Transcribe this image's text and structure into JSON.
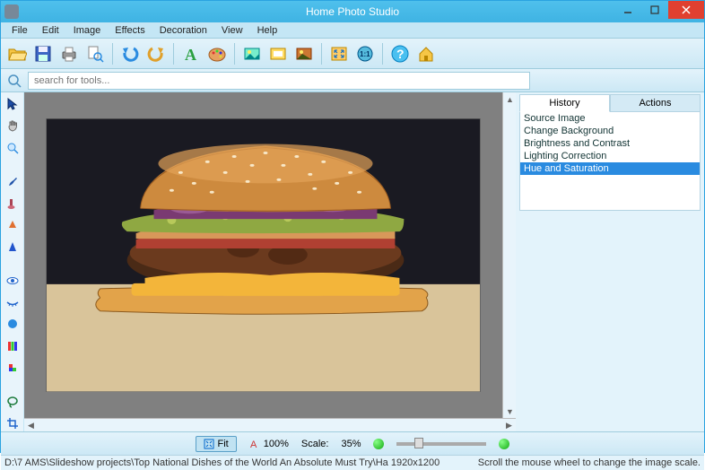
{
  "window": {
    "title": "Home Photo Studio"
  },
  "menu": {
    "items": [
      "File",
      "Edit",
      "Image",
      "Effects",
      "Decoration",
      "View",
      "Help"
    ]
  },
  "toolbar": {
    "icons": [
      "folder-open",
      "save",
      "print",
      "find",
      "sep",
      "undo",
      "redo",
      "sep",
      "text",
      "palette",
      "sep",
      "insert-image",
      "frame",
      "crop-picture",
      "sep",
      "fit-screen",
      "actual-size",
      "sep",
      "help",
      "home"
    ]
  },
  "search": {
    "placeholder": "search for tools..."
  },
  "tools": {
    "items": [
      "cursor",
      "hand",
      "magnifier",
      "brush",
      "clone-stamp",
      "gradient-cone",
      "shape",
      "eye-open",
      "eye-closed",
      "blue-circle",
      "color-bars",
      "smudge",
      "lasso",
      "crop"
    ]
  },
  "right_panel": {
    "tabs": [
      {
        "label": "History",
        "active": true
      },
      {
        "label": "Actions",
        "active": false
      }
    ],
    "history": [
      {
        "label": "Source Image",
        "selected": false
      },
      {
        "label": "Change Background",
        "selected": false
      },
      {
        "label": "Brightness and Contrast",
        "selected": false
      },
      {
        "label": "Lighting Correction",
        "selected": false
      },
      {
        "label": "Hue and Saturation",
        "selected": true
      }
    ]
  },
  "zoom": {
    "fit_label": "Fit",
    "hundred_label": "100%",
    "scale_label": "Scale:",
    "scale_value": "35%"
  },
  "status": {
    "path": "D:\\7 AMS\\Slideshow projects\\Top  National Dishes of the World  An Absolute Must Try\\Ha  1920x1200",
    "hint": "Scroll the mouse wheel to change the image scale."
  },
  "colors": {
    "accent": "#3fb3e3"
  }
}
